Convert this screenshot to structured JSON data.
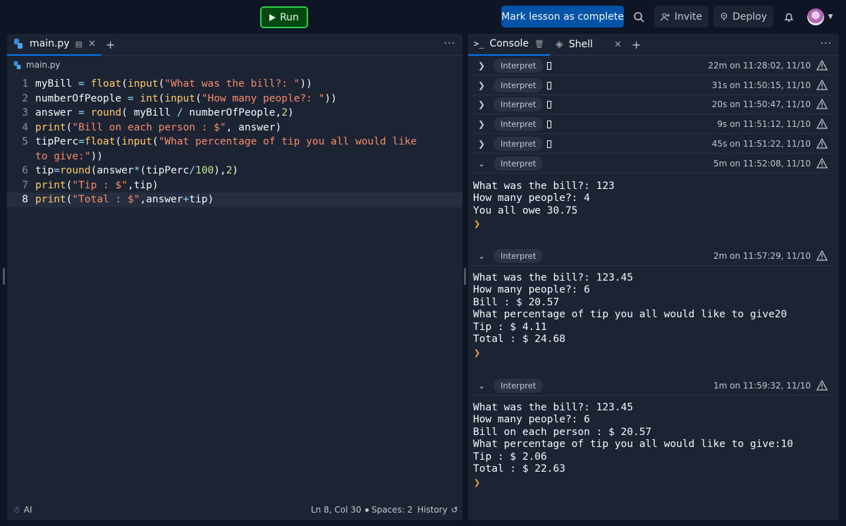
{
  "topbar": {
    "run_label": "Run",
    "mark_complete_label": "Mark lesson as complete",
    "invite_label": "Invite",
    "deploy_label": "Deploy",
    "accent_run": "#2dd04b",
    "accent_primary": "#0053a6"
  },
  "editor": {
    "tab_label": "main.py",
    "breadcrumb": "main.py",
    "lines": [
      {
        "num": "1"
      },
      {
        "num": "2"
      },
      {
        "num": "3"
      },
      {
        "num": "4"
      },
      {
        "num": "5"
      },
      {
        "num": "6"
      },
      {
        "num": "7"
      },
      {
        "num": "8"
      }
    ],
    "code": [
      "myBill = float(input(\"What was the bill?: \"))",
      "numberOfPeople = int(input(\"How many people?: \"))",
      "answer = round( myBill / numberOfPeople,2)",
      "print(\"Bill on each person : $\", answer)",
      "tipPerc=float(input(\"What percentage of tip you all would like to give:\"))",
      "tip=round(answer*(tipPerc/100),2)",
      "print(\"Tip : $\",tip)",
      "print(\"Total : $\",answer+tip)"
    ],
    "status": {
      "ai_label": "AI",
      "position": "Ln 8, Col 30",
      "spaces": "Spaces: 2",
      "history": "History"
    }
  },
  "console": {
    "tab_console": "Console",
    "tab_shell": "Shell",
    "entries": [
      {
        "badge": "Interpret",
        "time": "22m on 11:28:02, 11/10"
      },
      {
        "badge": "Interpret",
        "time": "31s on 11:50:15, 11/10"
      },
      {
        "badge": "Interpret",
        "time": "20s on 11:50:47, 11/10"
      },
      {
        "badge": "Interpret",
        "time": "9s on 11:51:12, 11/10"
      },
      {
        "badge": "Interpret",
        "time": "45s on 11:51:22, 11/10"
      },
      {
        "badge": "Interpret",
        "time": "5m on 11:52:08, 11/10"
      },
      {
        "badge": "Interpret",
        "time": "2m on 11:57:29, 11/10"
      },
      {
        "badge": "Interpret",
        "time": "1m on 11:59:32, 11/10"
      }
    ],
    "outputs": [
      "What was the bill?: 123\nHow many people?: 4\nYou all owe 30.75",
      "What was the bill?: 123.45\nHow many people?: 6\nBill : $ 20.57\nWhat percentage of tip you all would like to give20\nTip : $ 4.11\nTotal : $ 24.68",
      "What was the bill?: 123.45\nHow many people?: 6\nBill on each person : $ 20.57\nWhat percentage of tip you all would like to give:10\nTip : $ 2.06\nTotal : $ 22.63"
    ]
  }
}
